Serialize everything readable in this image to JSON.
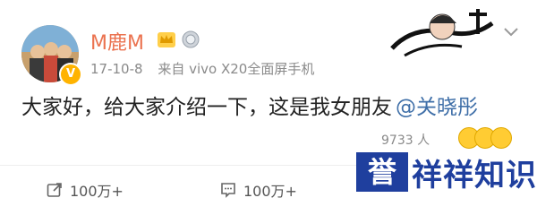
{
  "post": {
    "username": "M鹿M",
    "timestamp": "17-10-8",
    "source": "来自 vivo X20全面屏手机",
    "content_text": "大家好，给大家介绍一下，这是我女朋友",
    "mention": "@关晓彤",
    "likes_count": "9733 人",
    "verified_badge": "V"
  },
  "actions": {
    "repost_count": "100万+",
    "comment_count": "100万+"
  },
  "watermark": {
    "box_char": "誉",
    "text": "祥祥知识"
  },
  "colors": {
    "username": "#eb7350",
    "mention": "#3f6fa8",
    "verified": "#ffb300",
    "watermark": "#1f3f9e"
  },
  "icons": [
    "crown-badge-icon",
    "medal-badge-icon",
    "chevron-down-icon",
    "repost-icon",
    "comment-icon",
    "emoji-reaction-icon"
  ]
}
